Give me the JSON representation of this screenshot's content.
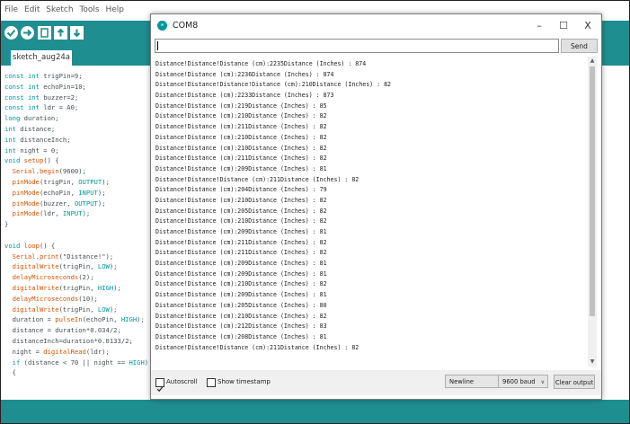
{
  "ide": {
    "menus": [
      "File",
      "Edit",
      "Sketch",
      "Tools",
      "Help"
    ],
    "sketch_tab": "sketch_aug24a",
    "code_lines": [
      [
        {
          "t": "const int",
          "c": "kw"
        },
        {
          "t": " trigPin=9;"
        }
      ],
      [
        {
          "t": "const int",
          "c": "kw"
        },
        {
          "t": " echoPin=10;"
        }
      ],
      [
        {
          "t": "const int",
          "c": "kw"
        },
        {
          "t": " buzzer=2;"
        }
      ],
      [
        {
          "t": "const int",
          "c": "kw"
        },
        {
          "t": " ldr = A0;"
        }
      ],
      [
        {
          "t": "long",
          "c": "kw"
        },
        {
          "t": " duration;"
        }
      ],
      [
        {
          "t": "int",
          "c": "kw"
        },
        {
          "t": " distance;"
        }
      ],
      [
        {
          "t": "int",
          "c": "kw"
        },
        {
          "t": " distanceInch;"
        }
      ],
      [
        {
          "t": "int",
          "c": "kw"
        },
        {
          "t": " night = 0;"
        }
      ],
      [
        {
          "t": "void",
          "c": "kw"
        },
        {
          "t": " "
        },
        {
          "t": "setup",
          "c": "fn"
        },
        {
          "t": "() {"
        }
      ],
      [
        {
          "t": "  "
        },
        {
          "t": "Serial",
          "c": "fn"
        },
        {
          "t": "."
        },
        {
          "t": "begin",
          "c": "fn"
        },
        {
          "t": "(9600);"
        }
      ],
      [
        {
          "t": "  "
        },
        {
          "t": "pinMode",
          "c": "fn"
        },
        {
          "t": "(trigPin, "
        },
        {
          "t": "OUTPUT",
          "c": "cst"
        },
        {
          "t": ");"
        }
      ],
      [
        {
          "t": "  "
        },
        {
          "t": "pinMode",
          "c": "fn"
        },
        {
          "t": "(echoPin, "
        },
        {
          "t": "INPUT",
          "c": "cst"
        },
        {
          "t": ");"
        }
      ],
      [
        {
          "t": "  "
        },
        {
          "t": "pinMode",
          "c": "fn"
        },
        {
          "t": "(buzzer, "
        },
        {
          "t": "OUTPUT",
          "c": "cst"
        },
        {
          "t": ");"
        }
      ],
      [
        {
          "t": "  "
        },
        {
          "t": "pinMode",
          "c": "fn"
        },
        {
          "t": "(ldr, "
        },
        {
          "t": "INPUT",
          "c": "cst"
        },
        {
          "t": ");"
        }
      ],
      [
        {
          "t": "}"
        }
      ],
      [
        {
          "t": ""
        }
      ],
      [
        {
          "t": "void",
          "c": "kw"
        },
        {
          "t": " "
        },
        {
          "t": "loop",
          "c": "fn"
        },
        {
          "t": "() {"
        }
      ],
      [
        {
          "t": "  "
        },
        {
          "t": "Serial",
          "c": "fn"
        },
        {
          "t": "."
        },
        {
          "t": "print",
          "c": "fn"
        },
        {
          "t": "(\"Distance!\");"
        }
      ],
      [
        {
          "t": "  "
        },
        {
          "t": "digitalWrite",
          "c": "fn"
        },
        {
          "t": "(trigPin, "
        },
        {
          "t": "LOW",
          "c": "cst"
        },
        {
          "t": ");"
        }
      ],
      [
        {
          "t": "  "
        },
        {
          "t": "delayMicroseconds",
          "c": "fn"
        },
        {
          "t": "(2);"
        }
      ],
      [
        {
          "t": "  "
        },
        {
          "t": "digitalWrite",
          "c": "fn"
        },
        {
          "t": "(trigPin, "
        },
        {
          "t": "HIGH",
          "c": "cst"
        },
        {
          "t": ");"
        }
      ],
      [
        {
          "t": "  "
        },
        {
          "t": "delayMicroseconds",
          "c": "fn"
        },
        {
          "t": "(10);"
        }
      ],
      [
        {
          "t": "  "
        },
        {
          "t": "digitalWrite",
          "c": "fn"
        },
        {
          "t": "(trigPin, "
        },
        {
          "t": "LOW",
          "c": "cst"
        },
        {
          "t": ");"
        }
      ],
      [
        {
          "t": "  duration = "
        },
        {
          "t": "pulseIn",
          "c": "fn"
        },
        {
          "t": "(echoPin, "
        },
        {
          "t": "HIGH",
          "c": "cst"
        },
        {
          "t": ");"
        }
      ],
      [
        {
          "t": "  distance = duration*0.034/2;"
        }
      ],
      [
        {
          "t": "  distanceInch=duration*0.0133/2;"
        }
      ],
      [
        {
          "t": "  night = "
        },
        {
          "t": "digitalRead",
          "c": "fn"
        },
        {
          "t": "(ldr);"
        }
      ],
      [
        {
          "t": "  "
        },
        {
          "t": "if",
          "c": "kw"
        },
        {
          "t": " (distance < 70 || night == "
        },
        {
          "t": "HIGH",
          "c": "cst"
        },
        {
          "t": ")"
        }
      ],
      [
        {
          "t": "  {"
        }
      ]
    ]
  },
  "serial": {
    "title": "COM8",
    "send_label": "Send",
    "input_value": "",
    "output_lines": [
      "Distance!Distance!Distance (cm):2235Distance (Inches) : 874",
      "Distance!Distance (cm):2236Distance (Inches) : 874",
      "Distance!Distance!Distance!Distance (cm):210Distance (Inches) : 82",
      "Distance!Distance (cm):2233Distance (Inches) : 873",
      "Distance!Distance (cm):219Distance (Inches) : 85",
      "Distance!Distance (cm):210Distance (Inches) : 82",
      "Distance!Distance (cm):211Distance (Inches) : 82",
      "Distance!Distance (cm):210Distance (Inches) : 82",
      "Distance!Distance (cm):210Distance (Inches) : 82",
      "Distance!Distance (cm):211Distance (Inches) : 82",
      "Distance!Distance (cm):209Distance (Inches) : 81",
      "Distance!Distance!Distance (cm):211Distance (Inches) : 82",
      "Distance!Distance (cm):204Distance (Inches) : 79",
      "Distance!Distance (cm):210Distance (Inches) : 82",
      "Distance!Distance (cm):205Distance (Inches) : 82",
      "Distance!Distance (cm):210Distance (Inches) : 82",
      "Distance!Distance (cm):209Distance (Inches) : 81",
      "Distance!Distance (cm):211Distance (Inches) : 82",
      "Distance!Distance (cm):211Distance (Inches) : 82",
      "Distance!Distance (cm):209Distance (Inches) : 81",
      "Distance!Distance (cm):209Distance (Inches) : 81",
      "Distance!Distance (cm):210Distance (Inches) : 82",
      "Distance!Distance (cm):209Distance (Inches) : 81",
      "Distance!Distance (cm):205Distance (Inches) : 80",
      "Distance!Distance (cm):210Distance (Inches) : 82",
      "Distance!Distance (cm):212Distance (Inches) : 83",
      "Distance!Distance (cm):208Distance (Inches) : 81",
      "Distance!Distance!Distance (cm):211Distance (Inches) : 82"
    ],
    "autoscroll_label": "Autoscroll",
    "autoscroll_checked": true,
    "timestamp_label": "Show timestamp",
    "timestamp_checked": false,
    "line_ending": "Newline",
    "baud_rate": "9600 baud",
    "clear_label": "Clear output"
  },
  "colors": {
    "ide_teal": "#1f8e91",
    "keyword": "#00979c",
    "function": "#d35400"
  }
}
